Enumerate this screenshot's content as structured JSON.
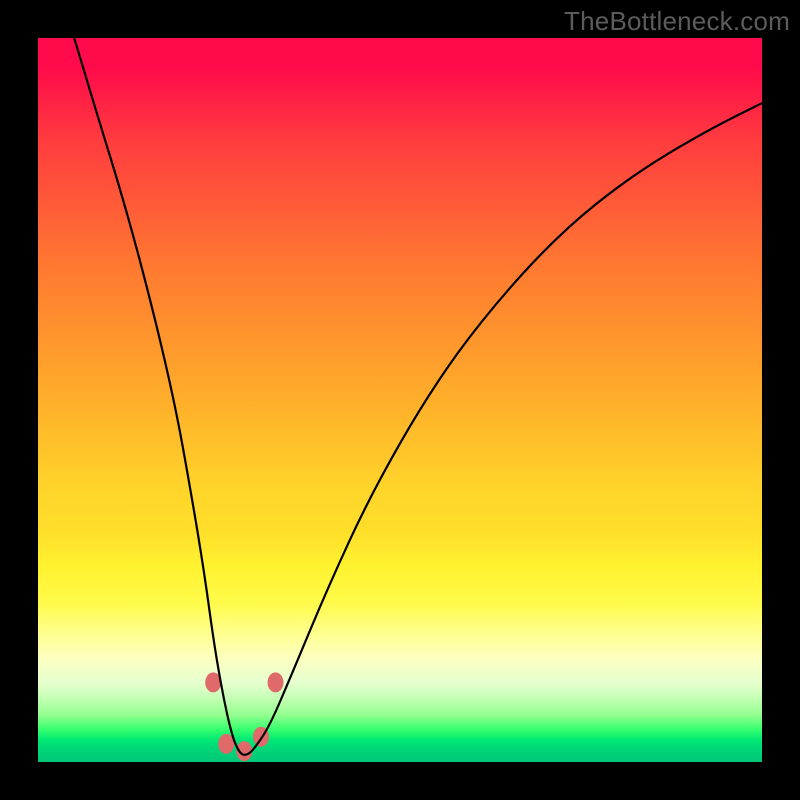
{
  "watermark": "TheBottleneck.com",
  "chart_data": {
    "type": "line",
    "title": "",
    "xlabel": "",
    "ylabel": "",
    "xlim": [
      0,
      100
    ],
    "ylim": [
      0,
      100
    ],
    "grid": false,
    "legend": false,
    "annotations": [
      {
        "text": "TheBottleneck.com",
        "position": "top-right"
      }
    ],
    "series": [
      {
        "name": "bottleneck-curve",
        "color": "#000000",
        "x": [
          5,
          8,
          12,
          16,
          19,
          21,
          23,
          24.5,
          26,
          27,
          28,
          29,
          30,
          32,
          35,
          40,
          46,
          54,
          62,
          72,
          82,
          92,
          100
        ],
        "y": [
          100,
          90,
          77,
          62,
          49,
          38,
          26,
          15,
          7,
          3,
          1,
          1,
          2,
          5,
          12,
          24,
          37,
          51,
          62,
          73,
          81,
          87,
          91
        ]
      }
    ],
    "markers": [
      {
        "x": 24.2,
        "y": 11,
        "color": "#e06a6a",
        "r": 8
      },
      {
        "x": 26.0,
        "y": 2.5,
        "color": "#e06a6a",
        "r": 8
      },
      {
        "x": 28.5,
        "y": 1.5,
        "color": "#e06a6a",
        "r": 8
      },
      {
        "x": 30.8,
        "y": 3.5,
        "color": "#e06a6a",
        "r": 8
      },
      {
        "x": 32.8,
        "y": 11,
        "color": "#e06a6a",
        "r": 8
      }
    ]
  }
}
